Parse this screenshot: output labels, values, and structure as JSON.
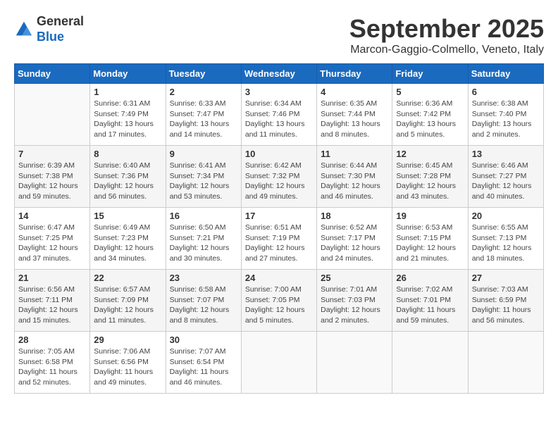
{
  "header": {
    "logo": {
      "line1": "General",
      "line2": "Blue"
    },
    "month": "September 2025",
    "location": "Marcon-Gaggio-Colmello, Veneto, Italy"
  },
  "weekdays": [
    "Sunday",
    "Monday",
    "Tuesday",
    "Wednesday",
    "Thursday",
    "Friday",
    "Saturday"
  ],
  "weeks": [
    [
      {
        "day": "",
        "info": ""
      },
      {
        "day": "1",
        "info": "Sunrise: 6:31 AM\nSunset: 7:49 PM\nDaylight: 13 hours\nand 17 minutes."
      },
      {
        "day": "2",
        "info": "Sunrise: 6:33 AM\nSunset: 7:47 PM\nDaylight: 13 hours\nand 14 minutes."
      },
      {
        "day": "3",
        "info": "Sunrise: 6:34 AM\nSunset: 7:46 PM\nDaylight: 13 hours\nand 11 minutes."
      },
      {
        "day": "4",
        "info": "Sunrise: 6:35 AM\nSunset: 7:44 PM\nDaylight: 13 hours\nand 8 minutes."
      },
      {
        "day": "5",
        "info": "Sunrise: 6:36 AM\nSunset: 7:42 PM\nDaylight: 13 hours\nand 5 minutes."
      },
      {
        "day": "6",
        "info": "Sunrise: 6:38 AM\nSunset: 7:40 PM\nDaylight: 13 hours\nand 2 minutes."
      }
    ],
    [
      {
        "day": "7",
        "info": "Sunrise: 6:39 AM\nSunset: 7:38 PM\nDaylight: 12 hours\nand 59 minutes."
      },
      {
        "day": "8",
        "info": "Sunrise: 6:40 AM\nSunset: 7:36 PM\nDaylight: 12 hours\nand 56 minutes."
      },
      {
        "day": "9",
        "info": "Sunrise: 6:41 AM\nSunset: 7:34 PM\nDaylight: 12 hours\nand 53 minutes."
      },
      {
        "day": "10",
        "info": "Sunrise: 6:42 AM\nSunset: 7:32 PM\nDaylight: 12 hours\nand 49 minutes."
      },
      {
        "day": "11",
        "info": "Sunrise: 6:44 AM\nSunset: 7:30 PM\nDaylight: 12 hours\nand 46 minutes."
      },
      {
        "day": "12",
        "info": "Sunrise: 6:45 AM\nSunset: 7:28 PM\nDaylight: 12 hours\nand 43 minutes."
      },
      {
        "day": "13",
        "info": "Sunrise: 6:46 AM\nSunset: 7:27 PM\nDaylight: 12 hours\nand 40 minutes."
      }
    ],
    [
      {
        "day": "14",
        "info": "Sunrise: 6:47 AM\nSunset: 7:25 PM\nDaylight: 12 hours\nand 37 minutes."
      },
      {
        "day": "15",
        "info": "Sunrise: 6:49 AM\nSunset: 7:23 PM\nDaylight: 12 hours\nand 34 minutes."
      },
      {
        "day": "16",
        "info": "Sunrise: 6:50 AM\nSunset: 7:21 PM\nDaylight: 12 hours\nand 30 minutes."
      },
      {
        "day": "17",
        "info": "Sunrise: 6:51 AM\nSunset: 7:19 PM\nDaylight: 12 hours\nand 27 minutes."
      },
      {
        "day": "18",
        "info": "Sunrise: 6:52 AM\nSunset: 7:17 PM\nDaylight: 12 hours\nand 24 minutes."
      },
      {
        "day": "19",
        "info": "Sunrise: 6:53 AM\nSunset: 7:15 PM\nDaylight: 12 hours\nand 21 minutes."
      },
      {
        "day": "20",
        "info": "Sunrise: 6:55 AM\nSunset: 7:13 PM\nDaylight: 12 hours\nand 18 minutes."
      }
    ],
    [
      {
        "day": "21",
        "info": "Sunrise: 6:56 AM\nSunset: 7:11 PM\nDaylight: 12 hours\nand 15 minutes."
      },
      {
        "day": "22",
        "info": "Sunrise: 6:57 AM\nSunset: 7:09 PM\nDaylight: 12 hours\nand 11 minutes."
      },
      {
        "day": "23",
        "info": "Sunrise: 6:58 AM\nSunset: 7:07 PM\nDaylight: 12 hours\nand 8 minutes."
      },
      {
        "day": "24",
        "info": "Sunrise: 7:00 AM\nSunset: 7:05 PM\nDaylight: 12 hours\nand 5 minutes."
      },
      {
        "day": "25",
        "info": "Sunrise: 7:01 AM\nSunset: 7:03 PM\nDaylight: 12 hours\nand 2 minutes."
      },
      {
        "day": "26",
        "info": "Sunrise: 7:02 AM\nSunset: 7:01 PM\nDaylight: 11 hours\nand 59 minutes."
      },
      {
        "day": "27",
        "info": "Sunrise: 7:03 AM\nSunset: 6:59 PM\nDaylight: 11 hours\nand 56 minutes."
      }
    ],
    [
      {
        "day": "28",
        "info": "Sunrise: 7:05 AM\nSunset: 6:58 PM\nDaylight: 11 hours\nand 52 minutes."
      },
      {
        "day": "29",
        "info": "Sunrise: 7:06 AM\nSunset: 6:56 PM\nDaylight: 11 hours\nand 49 minutes."
      },
      {
        "day": "30",
        "info": "Sunrise: 7:07 AM\nSunset: 6:54 PM\nDaylight: 11 hours\nand 46 minutes."
      },
      {
        "day": "",
        "info": ""
      },
      {
        "day": "",
        "info": ""
      },
      {
        "day": "",
        "info": ""
      },
      {
        "day": "",
        "info": ""
      }
    ]
  ]
}
